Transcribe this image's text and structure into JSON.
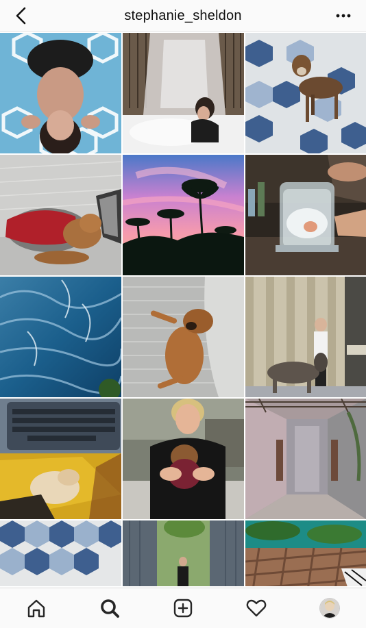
{
  "header": {
    "username": "stephanie_sheldon",
    "back_icon": "chevron-left-icon",
    "more_icon": "more-horizontal-icon"
  },
  "grid": {
    "photos": [
      "woman-lying-on-blue-tiles",
      "woman-in-bed-with-canopy",
      "puppy-standing-on-patterned-tiles",
      "dog-sleeping-in-red-sweater",
      "palm-trees-at-pink-sunset",
      "cocktail-in-glass-jar",
      "ocean-water-texture",
      "puppy-lying-on-pillow",
      "woman-with-donkey",
      "keyboard-and-puppy-on-yellow",
      "smiling-woman-holding-puppy",
      "concrete-corridor",
      "hexagon-tile-floor",
      "person-in-wooden-doorway",
      "wooden-deck-with-palms"
    ]
  },
  "tabbar": {
    "items": [
      {
        "name": "home",
        "icon": "home-icon"
      },
      {
        "name": "search",
        "icon": "search-icon",
        "active": true
      },
      {
        "name": "new-post",
        "icon": "plus-square-icon"
      },
      {
        "name": "activity",
        "icon": "heart-icon"
      },
      {
        "name": "profile",
        "icon": "avatar"
      }
    ]
  },
  "colors": {
    "header_bg": "#fafafa",
    "tabbar_bg": "#fafafa",
    "text": "#111111"
  }
}
